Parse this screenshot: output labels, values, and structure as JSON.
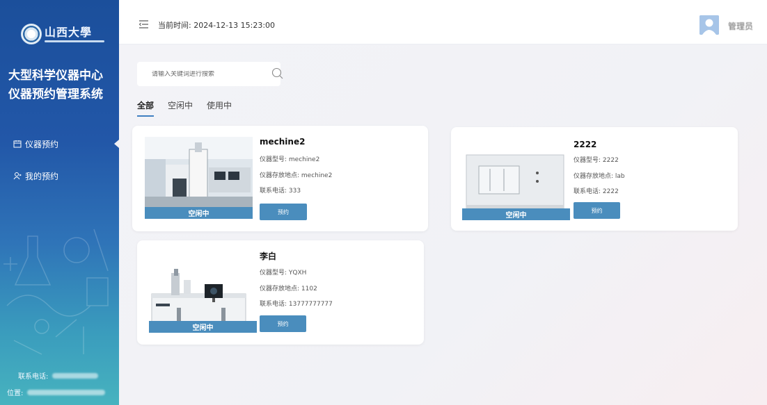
{
  "sidebar": {
    "logo_text": "山西大學",
    "title_line1": "大型科学仪器中心",
    "title_line2": "仪器预约管理系统",
    "nav": [
      {
        "label": "仪器预约",
        "icon": "calendar-icon",
        "active": true
      },
      {
        "label": "我的预约",
        "icon": "user-icon",
        "active": false
      }
    ],
    "contact_label": "联系电话:",
    "location_label": "位置:"
  },
  "header": {
    "menu_icon": "menu-fold-icon",
    "time_label": "当前时间: 2024-12-13 15:23:00",
    "username": "管理员"
  },
  "search": {
    "placeholder": "请输入关键词进行搜索",
    "icon": "search-icon"
  },
  "tabs": [
    {
      "label": "全部",
      "active": true
    },
    {
      "label": "空闲中",
      "active": false
    },
    {
      "label": "使用中",
      "active": false
    }
  ],
  "colors": {
    "accent": "#4a8dbd",
    "sidebar_top": "#1b4f9b",
    "sidebar_bottom": "#47b3bf"
  },
  "instruments": [
    {
      "name": "mechine2",
      "model": "仪器型号: mechine2",
      "location": "仪器存放地点: mechine2",
      "phone": "联系电话: 333",
      "status": "空闲中",
      "button": "预约"
    },
    {
      "name": "2222",
      "model": "仪器型号: 2222",
      "location": "仪器存放地点: lab",
      "phone": "联系电话: 2222",
      "status": "空闲中",
      "button": "预约"
    },
    {
      "name": "李白",
      "model": "仪器型号: YQXH",
      "location": "仪器存放地点: 1102",
      "phone": "联系电话: 13777777777",
      "status": "空闲中",
      "button": "预约"
    }
  ]
}
